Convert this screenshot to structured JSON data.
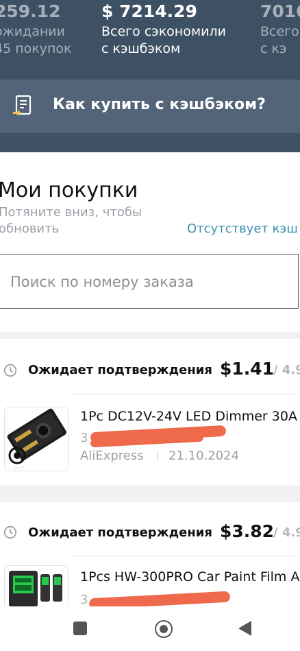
{
  "stats": {
    "pending": {
      "value": "259.12",
      "label_line1": "ожидании",
      "label_line2": "45 покупок"
    },
    "saved": {
      "value": "$ 7214.29",
      "label_line1": "Всего сэкономили",
      "label_line2": "с кэшбэком"
    },
    "other": {
      "value": "7016",
      "label_line1": "Всего",
      "label_line2": "с кэ"
    }
  },
  "howto": {
    "label": "Как купить с кэшбэком?",
    "icon": "checklist-icon"
  },
  "purchases": {
    "title": "Мои покупки",
    "hint": "Потяните вниз, чтобы обновить",
    "missing_link": "Отсутствует кэш"
  },
  "search": {
    "placeholder": "Поиск по номеру заказа"
  },
  "orders": [
    {
      "status": "Ожидает подтверждения",
      "amount": "$1.41",
      "slash": "/ 4.9",
      "product": "1Pc DC12V-24V LED Dimmer 30A",
      "order_prefix": "3",
      "shop": "AliExpress",
      "date": "21.10.2024"
    },
    {
      "status": "Ожидает подтверждения",
      "amount": "$3.82",
      "slash": "/ 4.9",
      "product": "1Pcs HW-300PRO Car Paint Film A",
      "order_prefix": "3"
    }
  ],
  "colors": {
    "header_bg": "#3d5064",
    "howto_bg": "#536478",
    "link": "#3a8fb0",
    "redaction": "#ef6a4d"
  }
}
